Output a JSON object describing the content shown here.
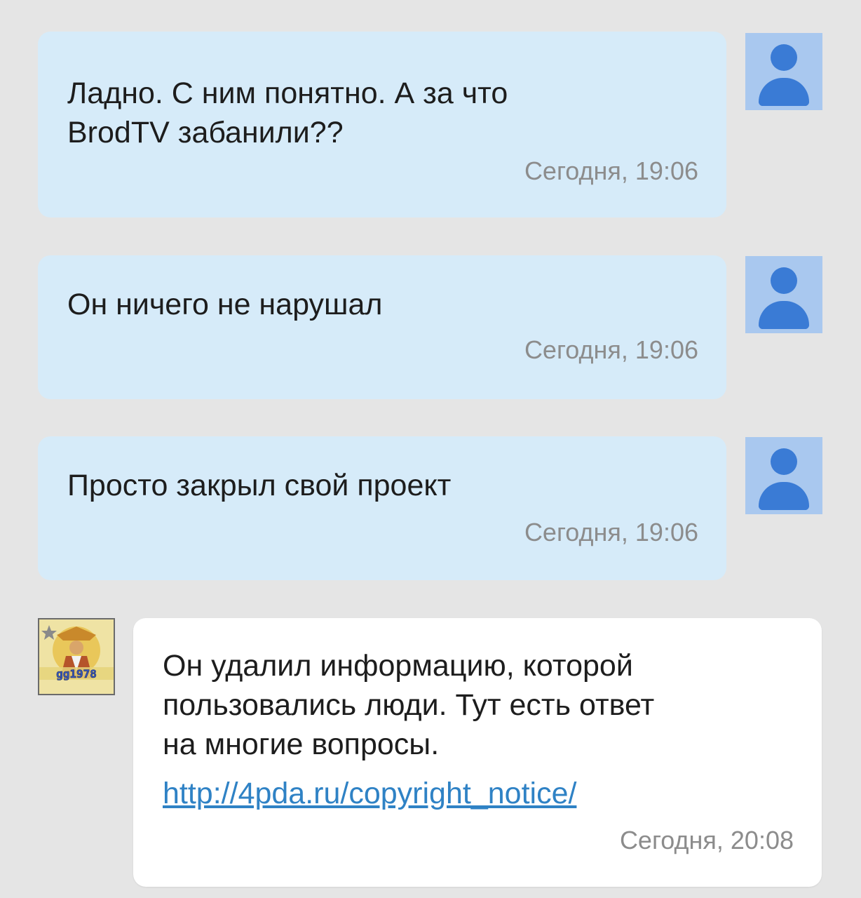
{
  "colors": {
    "background": "#e5e5e5",
    "outgoing_bubble": "#d6ebf9",
    "incoming_bubble": "#ffffff",
    "text": "#1d1d1d",
    "timestamp": "#8c8c8c",
    "link": "#2f82c5",
    "avatar_bg": "#a9c8ef",
    "avatar_fg": "#3a7bd5"
  },
  "messages": [
    {
      "direction": "outgoing",
      "text": "Ладно. С ним понятно. А за что\nBrodTV забанили??",
      "time": "Сегодня, 19:06",
      "avatar_icon": "default-user-icon"
    },
    {
      "direction": "outgoing",
      "text": "Он ничего не нарушал",
      "time": "Сегодня, 19:06",
      "avatar_icon": "default-user-icon"
    },
    {
      "direction": "outgoing",
      "text": "Просто закрыл свой проект",
      "time": "Сегодня, 19:06",
      "avatar_icon": "default-user-icon"
    },
    {
      "direction": "incoming",
      "text": "Он удалил информацию, которой\nпользовались люди. Тут есть ответ\nна многие вопросы.",
      "link": "http://4pda.ru/copyright_notice/",
      "time": "Сегодня, 20:08",
      "avatar_icon": "user-avatar-image",
      "avatar_caption": "gg1978"
    }
  ]
}
